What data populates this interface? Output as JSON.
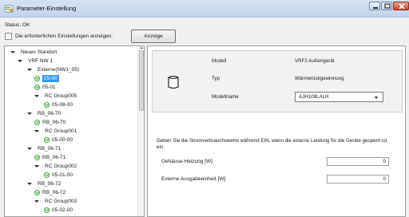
{
  "window": {
    "title": "Parameter-Einstellung"
  },
  "status": {
    "text": "Status: OK"
  },
  "options": {
    "show_required_label": "Die erforderlichen Einstellungen anzeigen.",
    "show_button": "Anzeige"
  },
  "tree": {
    "items": [
      {
        "label": "Neues Standort",
        "level": 0,
        "type": "expand"
      },
      {
        "label": "VRF NW 1",
        "level": 1,
        "type": "expand"
      },
      {
        "label": "Externe(NW1_05)",
        "level": 2,
        "type": "expand"
      },
      {
        "label": "05-00",
        "level": 3,
        "type": "ok",
        "selected": true
      },
      {
        "label": "05-01",
        "level": 3,
        "type": "ok"
      },
      {
        "label": "RC Group005",
        "level": 3,
        "type": "expand"
      },
      {
        "label": "05-08-00",
        "level": 4,
        "type": "ok"
      },
      {
        "label": "RB_06-70",
        "level": 2,
        "type": "expand"
      },
      {
        "label": "RB_06-70",
        "level": 3,
        "type": "ok"
      },
      {
        "label": "RC Group001",
        "level": 3,
        "type": "expand"
      },
      {
        "label": "05-00-00",
        "level": 4,
        "type": "ok"
      },
      {
        "label": "RB_06-71",
        "level": 2,
        "type": "expand"
      },
      {
        "label": "RB_06-71",
        "level": 3,
        "type": "ok"
      },
      {
        "label": "RC Group002",
        "level": 3,
        "type": "expand"
      },
      {
        "label": "05-01-00",
        "level": 4,
        "type": "ok"
      },
      {
        "label": "RB_06-72",
        "level": 2,
        "type": "expand"
      },
      {
        "label": "RB_06-72",
        "level": 3,
        "type": "ok"
      },
      {
        "label": "RC Group003",
        "level": 3,
        "type": "expand"
      },
      {
        "label": "05-02-00",
        "level": 4,
        "type": "ok"
      }
    ]
  },
  "device": {
    "model_label": "Modell",
    "model_value": "VRF2 Außengerät",
    "type_label": "Typ",
    "type_value": "Wärmerückgewinnung",
    "model_name_label": "Modellname",
    "model_name_value": "AJH108LALH"
  },
  "power": {
    "description": "Geben Sie die Stromverbrauchswerte während EIN, wenn die externe Leistung für die Geräte gesperrt ist, ein.",
    "heater_label": "Gehäuse-Heizung [W]",
    "heater_value": "0",
    "aux_label": "Externe Ausgabeeinheit [W]",
    "aux_value": "0"
  },
  "colors": {
    "selection": "#3399ff",
    "ok_green": "#3fa23a"
  }
}
